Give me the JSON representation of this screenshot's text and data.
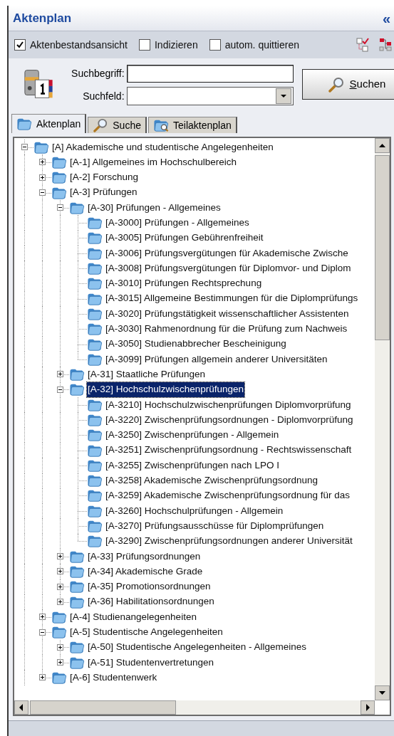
{
  "header": {
    "title": "Aktenplan",
    "collapse": "«"
  },
  "options": [
    {
      "label": "Aktenbestandsansicht",
      "checked": true
    },
    {
      "label": "Indizieren",
      "checked": false
    },
    {
      "label": "autom. quittieren",
      "checked": false
    }
  ],
  "search": {
    "term_label": "Suchbegriff:",
    "field_label": "Suchfeld:",
    "button": "Suchen"
  },
  "tabs": [
    {
      "label": "Aktenplan",
      "selected": true
    },
    {
      "label": "Suche",
      "selected": false
    },
    {
      "label": "Teilaktenplan",
      "selected": false
    }
  ],
  "tree": [
    {
      "label": "[A] Akademische und studentische Angelegenheiten",
      "expanded": true,
      "selected": false,
      "children": [
        {
          "label": "[A-1] Allgemeines im Hochschulbereich",
          "expanded": false,
          "selected": false
        },
        {
          "label": "[A-2] Forschung",
          "expanded": false,
          "selected": false
        },
        {
          "label": "[A-3] Prüfungen",
          "expanded": true,
          "selected": false,
          "children": [
            {
              "label": "[A-30] Prüfungen - Allgemeines",
              "expanded": true,
              "selected": false,
              "children": [
                {
                  "label": "[A-3000] Prüfungen - Allgemeines",
                  "selected": false
                },
                {
                  "label": "[A-3005] Prüfungen Gebührenfreiheit",
                  "selected": false
                },
                {
                  "label": "[A-3006] Prüfungsvergütungen für Akademische Zwische",
                  "selected": false
                },
                {
                  "label": "[A-3008] Prüfungsvergütungen für Diplomvor- und Diplom",
                  "selected": false
                },
                {
                  "label": "[A-3010] Prüfungen Rechtsprechung",
                  "selected": false
                },
                {
                  "label": "[A-3015] Allgemeine Bestimmungen für die Diplomprüfungs",
                  "selected": false
                },
                {
                  "label": "[A-3020] Prüfungstätigkeit wissenschaftlicher Assistenten",
                  "selected": false
                },
                {
                  "label": "[A-3030] Rahmenordnung für die Prüfung zum Nachweis",
                  "selected": false
                },
                {
                  "label": "[A-3050] Studienabbrecher Bescheinigung",
                  "selected": false
                },
                {
                  "label": "[A-3099] Prüfungen allgemein anderer Universitäten",
                  "selected": false
                }
              ]
            },
            {
              "label": "[A-31] Staatliche Prüfungen",
              "expanded": false,
              "selected": false
            },
            {
              "label": "[A-32] Hochschulzwischenprüfungen",
              "expanded": true,
              "selected": true,
              "children": [
                {
                  "label": "[A-3210] Hochschulzwischenprüfungen Diplomvorprüfung",
                  "selected": false
                },
                {
                  "label": "[A-3220] Zwischenprüfungsordnungen - Diplomvorprüfung",
                  "selected": false
                },
                {
                  "label": "[A-3250] Zwischenprüfungen - Allgemein",
                  "selected": false
                },
                {
                  "label": "[A-3251] Zwischenprüfungsordnung - Rechtswissenschaft",
                  "selected": false
                },
                {
                  "label": "[A-3255] Zwischenprüfungen nach LPO I",
                  "selected": false
                },
                {
                  "label": "[A-3258] Akademische Zwischenprüfungsordnung",
                  "selected": false
                },
                {
                  "label": "[A-3259] Akademische Zwischenprüfungsordnung für das",
                  "selected": false
                },
                {
                  "label": "[A-3260] Hochschulprüfungen - Allgemein",
                  "selected": false
                },
                {
                  "label": "[A-3270] Prüfungsausschüsse für Diplomprüfungen",
                  "selected": false
                },
                {
                  "label": "[A-3290] Zwischenprüfungsordnungen anderer Universität",
                  "selected": false
                }
              ]
            },
            {
              "label": "[A-33] Prüfungsordnungen",
              "expanded": false,
              "selected": false
            },
            {
              "label": "[A-34] Akademische Grade",
              "expanded": false,
              "selected": false
            },
            {
              "label": "[A-35] Promotionsordnungen",
              "expanded": false,
              "selected": false
            },
            {
              "label": "[A-36] Habilitationsordnungen",
              "expanded": false,
              "selected": false
            }
          ]
        },
        {
          "label": "[A-4] Studienangelegenheiten",
          "expanded": false,
          "selected": false
        },
        {
          "label": "[A-5] Studentische Angelegenheiten",
          "expanded": true,
          "selected": false,
          "children": [
            {
              "label": "[A-50] Studentische Angelegenheiten - Allgemeines",
              "expanded": false,
              "selected": false
            },
            {
              "label": "[A-51] Studentenvertretungen",
              "expanded": false,
              "selected": false
            }
          ]
        },
        {
          "label": "[A-6] Studentenwerk",
          "expanded": false,
          "selected": false
        }
      ]
    }
  ]
}
